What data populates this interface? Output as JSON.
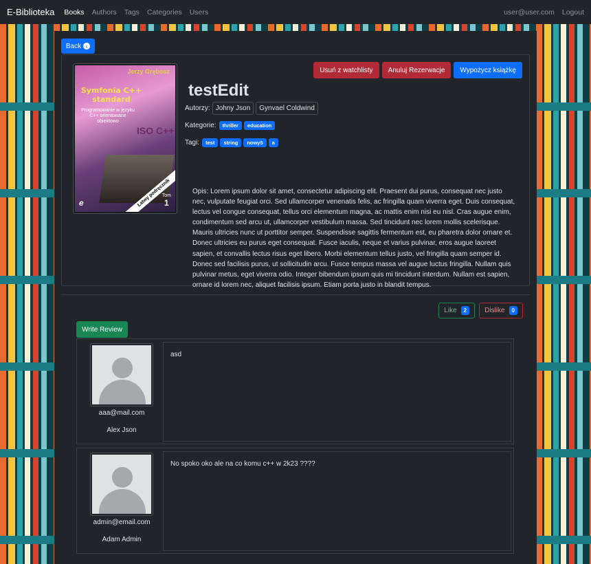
{
  "navbar": {
    "brand": "E-Biblioteka",
    "links": [
      "Books",
      "Authors",
      "Tags",
      "Categories",
      "Users"
    ],
    "user_email": "user@user.com",
    "logout": "Logout"
  },
  "back_label": "Back",
  "actions": {
    "watchlist_remove": "Usuń z watchlisty",
    "cancel_reservation": "Anuluj Rezerwacje",
    "borrow": "Wypożycz książkę"
  },
  "book": {
    "title": "testEdit",
    "authors_label": "Autorzy:",
    "authors": [
      "Johny Json",
      "Gynvael Coldwind"
    ],
    "categories_label": "Kategorie:",
    "categories": [
      "thriller",
      "education"
    ],
    "tags_label": "Tagi:",
    "tags": [
      "test",
      "string",
      "nowy5",
      "a"
    ],
    "description": "Opis: Lorem ipsum dolor sit amet, consectetur adipiscing elit. Praesent dui purus, consequat nec justo nec, vulputate feugiat orci. Sed ullamcorper venenatis felis, ac fringilla quam viverra eget. Duis consequat, lectus vel congue consequat, tellus orci elementum magna, ac mattis enim nisi eu nisl. Cras augue enim, condimentum sed arcu ut, ullamcorper vestibulum massa. Sed tincidunt nec lorem mollis scelerisque. Mauris ultricies nunc ut porttitor semper. Suspendisse sagittis fermentum est, eu pharetra dolor ornare et. Donec ultricies eu purus eget consequat. Fusce iaculis, neque et varius pulvinar, eros augue laoreet sapien, et convallis lectus risus eget libero. Morbi elementum tellus justo, vel fringilla quam semper id. Donec sed facilisis purus, ut sollicitudin arcu. Fusce tempus massa vel augue luctus fringilla. Nullam quis pulvinar metus, eget viverra odio. Integer bibendum ipsum quis mi tincidunt interdum. Nullam est sapien, ornare id lorem nec, aliquet facilisis ipsum. Etiam porta justo in blandit tempus."
  },
  "cover": {
    "author": "Jerzy Grębosz",
    "title": "Symfonia C++ standard",
    "subtitle": "Programowanie w języku C++ orientowane obiektowo",
    "iso": "ISO C++",
    "ribbon": "Łatwy podręcznik",
    "tom_label": "Tom",
    "tom_number": "1",
    "publisher_mark": "e"
  },
  "reactions": {
    "like_label": "Like",
    "like_count": "2",
    "dislike_label": "Dislike",
    "dislike_count": "0"
  },
  "write_review_label": "Write Review",
  "reviews": [
    {
      "email": "aaa@mail.com",
      "name": "Alex Json",
      "text": "asd"
    },
    {
      "email": "admin@email.com",
      "name": "Adam Admin",
      "text": "No spoko oko ale na co komu c++ w 2k23 ????"
    }
  ]
}
